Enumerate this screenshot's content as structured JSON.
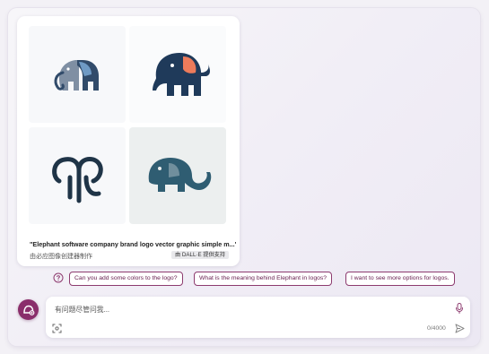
{
  "image_card": {
    "caption": "\"Elephant software company brand logo vector graphic simple m...\"",
    "made_by": "由必应图像创建器制作",
    "powered_by": "由 DALL·E 提供支持",
    "images": [
      {
        "icon": "elephant-logo-blue-grey"
      },
      {
        "icon": "elephant-logo-navy-orange-ear"
      },
      {
        "icon": "elephant-logo-outline-trunk"
      },
      {
        "icon": "elephant-logo-teal-silhouette"
      }
    ]
  },
  "suggestions": [
    "Can you add some colors to the logo?",
    "What is the meaning behind Elephant in logos?",
    "I want to see more options for logos."
  ],
  "composer": {
    "placeholder": "有问题尽管问我...",
    "counter": "0/4000"
  },
  "colors": {
    "accent": "#8a2e6b",
    "chip_border": "#8d3b6f",
    "elephant_navy": "#1f3a5a",
    "elephant_orange": "#ec7b5b",
    "elephant_teal": "#2f5d72"
  }
}
